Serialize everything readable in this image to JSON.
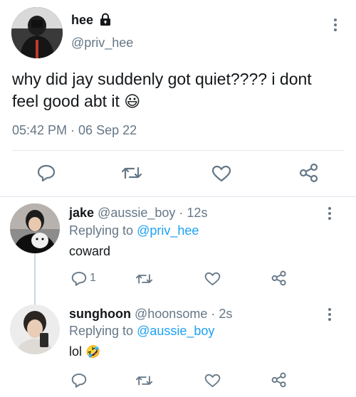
{
  "main_tweet": {
    "display_name": "hee",
    "handle": "@priv_hee",
    "text_line1": "why did jay suddenly got quiet???? i dont",
    "text_line2": "feel good abt it",
    "emoji": "😃",
    "timestamp": "05:42 PM · 06 Sep 22",
    "lock_icon": "lock-icon",
    "actions": [
      "reply-icon",
      "retweet-icon",
      "like-icon",
      "share-icon"
    ]
  },
  "replies": [
    {
      "display_name": "jake",
      "handle": "@aussie_boy",
      "time": "· 12s",
      "replying_label": "Replying to",
      "replying_handle": "@priv_hee",
      "text": "coward",
      "reply_count": "1"
    },
    {
      "display_name": "sunghoon",
      "handle": "@hoonsome",
      "time": "· 2s",
      "replying_label": "Replying to",
      "replying_handle": "@aussie_boy",
      "text": "lol",
      "emoji": "🤣",
      "reply_count": ""
    }
  ],
  "colors": {
    "accent": "#1da1f2",
    "secondary_text": "#657786",
    "divider": "#e1e8ed"
  }
}
